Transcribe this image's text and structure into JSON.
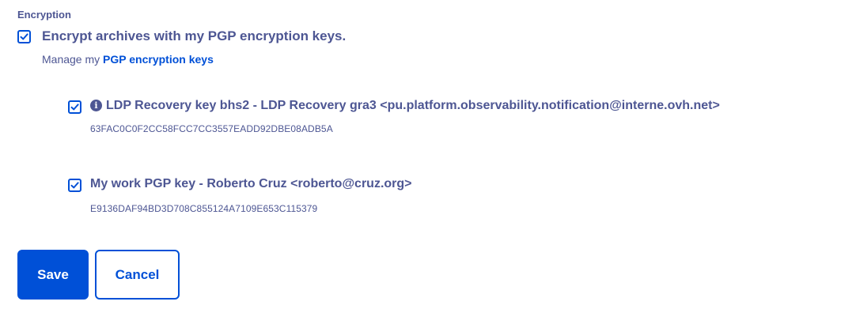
{
  "encryption": {
    "section_label": "Encryption",
    "main_option": {
      "checked": true,
      "label": "Encrypt archives with my PGP encryption keys."
    },
    "manage": {
      "prefix": "Manage my ",
      "link_label": "PGP encryption keys"
    },
    "keys": [
      {
        "checked": true,
        "has_info_icon": true,
        "title": "LDP Recovery key bhs2 - LDP Recovery gra3 <pu.platform.observability.notification@interne.ovh.net>",
        "fingerprint": "63FAC0C0F2CC58FCC7CC3557EADD92DBE08ADB5A"
      },
      {
        "checked": true,
        "has_info_icon": false,
        "title": "My work PGP key - Roberto Cruz <roberto@cruz.org>",
        "fingerprint": "E9136DAF94BD3D708C855124A7109E653C115379"
      }
    ]
  },
  "actions": {
    "save_label": "Save",
    "cancel_label": "Cancel"
  },
  "icons": {
    "checkbox": "checkmark-icon",
    "info": "info-circle-icon"
  },
  "colors": {
    "primary": "#0050d7",
    "text": "#4d5693",
    "background": "#ffffff"
  }
}
